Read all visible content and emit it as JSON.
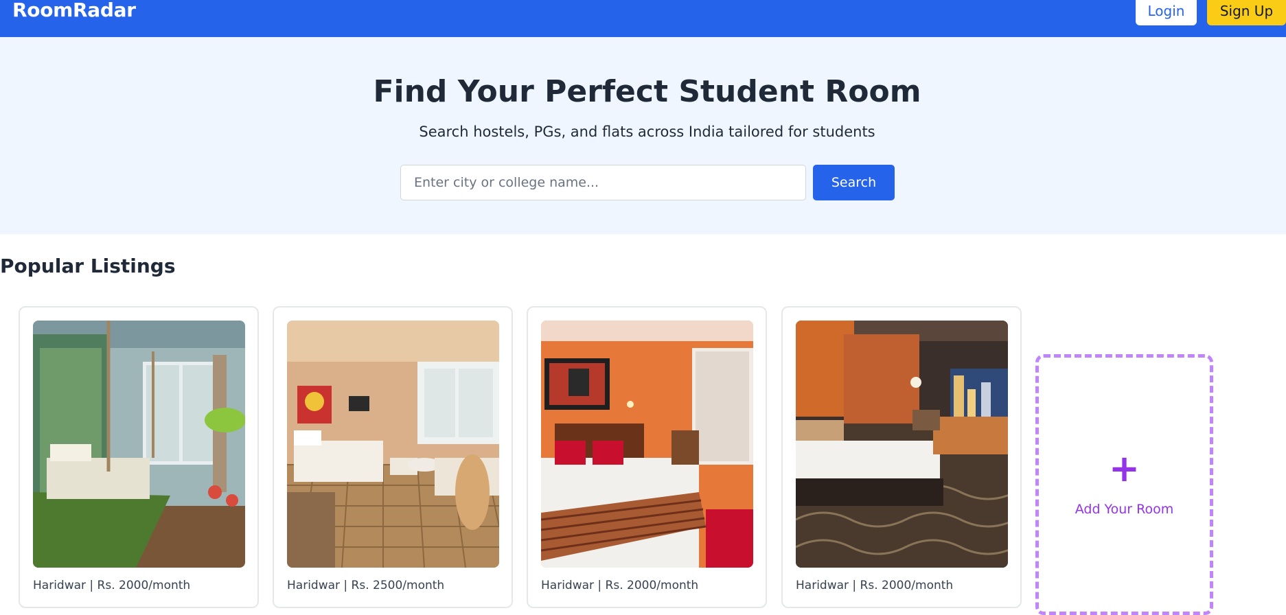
{
  "navbar": {
    "brand": "RoomRadar",
    "login_label": "Login",
    "signup_label": "Sign Up"
  },
  "hero": {
    "title": "Find Your Perfect Student Room",
    "subtitle": "Search hostels, PGs, and flats across India tailored for students",
    "search_placeholder": "Enter city or college name...",
    "search_value": "",
    "search_button": "Search"
  },
  "listings": {
    "title": "Popular Listings",
    "items": [
      {
        "city": "Haridwar",
        "price": "Rs. 2000/month",
        "info": "Haridwar | Rs. 2000/month",
        "photo": "jungle-themed-bedroom-photo"
      },
      {
        "city": "Haridwar",
        "price": "Rs. 2500/month",
        "info": "Haridwar | Rs. 2500/month",
        "photo": "hotel-bedroom-with-seating-photo"
      },
      {
        "city": "Haridwar",
        "price": "Rs. 2000/month",
        "info": "Haridwar | Rs. 2000/month",
        "photo": "orange-wall-bedroom-photo"
      },
      {
        "city": "Haridwar",
        "price": "Rs. 2000/month",
        "info": "Haridwar | Rs. 2000/month",
        "photo": "city-view-hotel-room-photo"
      }
    ],
    "add_card": {
      "icon": "plus-icon",
      "label": "Add Your Room"
    }
  },
  "colors": {
    "primary": "#2563eb",
    "signup": "#facc15",
    "hero_bg": "#eff6ff",
    "add_accent": "#9333ea",
    "add_border": "#c084fc"
  }
}
